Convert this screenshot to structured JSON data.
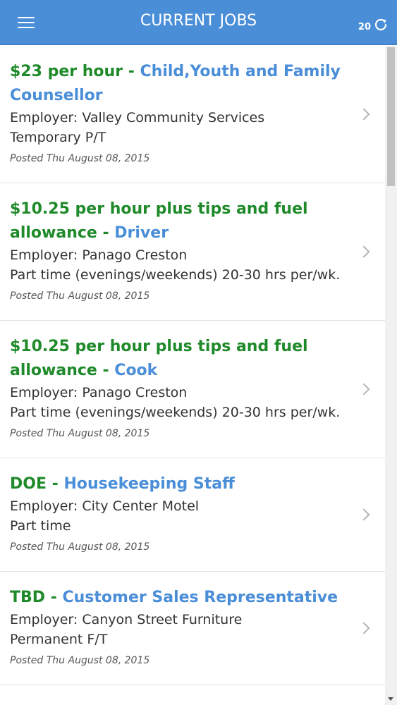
{
  "header": {
    "title": "CURRENT JOBS",
    "refresh_count": "20"
  },
  "jobs": [
    {
      "wage": "$23 per hour",
      "separator": " - ",
      "title": "Child,Youth and Family Counsellor",
      "employer": "Employer: Valley Community Services",
      "type": "Temporary P/T",
      "posted": "Posted Thu August 08, 2015"
    },
    {
      "wage": "$10.25 per hour plus tips and fuel allowance",
      "separator": " - ",
      "title": "Driver",
      "employer": "Employer: Panago Creston",
      "type": "Part time (evenings/weekends) 20-30 hrs per/wk.",
      "posted": "Posted Thu August 08, 2015"
    },
    {
      "wage": "$10.25 per hour plus tips and fuel allowance",
      "separator": " - ",
      "title": "Cook",
      "employer": "Employer: Panago Creston",
      "type": "Part time (evenings/weekends) 20-30 hrs per/wk.",
      "posted": "Posted Thu August 08, 2015"
    },
    {
      "wage": "DOE",
      "separator": " - ",
      "title": "Housekeeping Staff",
      "employer": "Employer: City Center Motel",
      "type": "Part time",
      "posted": "Posted Thu August 08, 2015"
    },
    {
      "wage": "TBD",
      "separator": " - ",
      "title": "Customer Sales Representative",
      "employer": "Employer: Canyon Street Furniture",
      "type": "Permanent F/T",
      "posted": "Posted Thu August 08, 2015"
    }
  ],
  "icons": {
    "menu": "hamburger-menu-icon",
    "refresh": "refresh-icon",
    "chevron": "chevron-right-icon"
  },
  "colors": {
    "header_bg": "#4a8ed8",
    "wage_green": "#1f8a2a",
    "job_title_blue": "#4a8ed8"
  }
}
